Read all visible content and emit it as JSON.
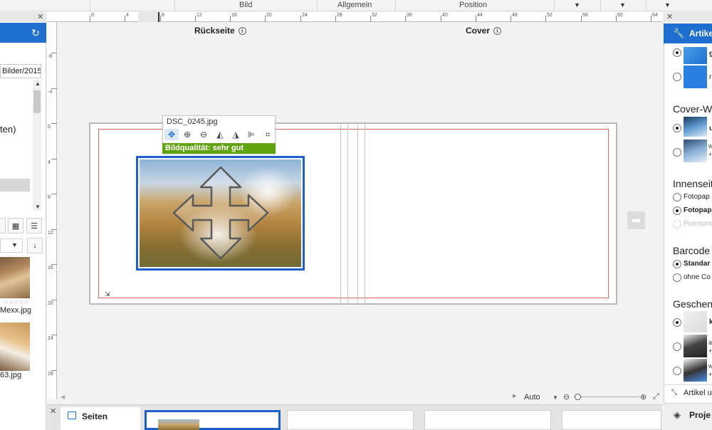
{
  "menu": {
    "tab_bild": "Bild",
    "tab_allgemein": "Allgemein",
    "tab_position": "Position"
  },
  "ruler": {
    "top_ticks": [
      "0",
      "4",
      "8",
      "12",
      "16",
      "20",
      "24",
      "28",
      "32",
      "36",
      "40",
      "44",
      "48",
      "52",
      "56",
      "60",
      "64"
    ],
    "left_ticks": [
      "-8",
      "-4",
      "0",
      "4",
      "8",
      "12",
      "16",
      "20",
      "24",
      "28"
    ]
  },
  "left_panel": {
    "path": "Bilder/2015/",
    "tree_text": "ten)",
    "photos": [
      {
        "filename": "Mexx.jpg",
        "stars": "☆☆☆☆☆"
      },
      {
        "filename": "63.jpg"
      }
    ]
  },
  "workspace": {
    "back_label": "Rückseite",
    "cover_label": "Cover",
    "info_glyph": "i",
    "zoom_value": "Auto"
  },
  "photo_popup": {
    "filename": "DSC_0245.jpg",
    "quality": "Bildqualität: sehr gut"
  },
  "pages": {
    "label": "Seiten"
  },
  "right_panel": {
    "title": "Artikel",
    "cover_header": "Cover-Wa",
    "inner_header": "Innenseit",
    "inner_options": [
      "Fotopap",
      "Fotopap",
      "Premium"
    ],
    "barcode_header": "Barcode",
    "barcode_options": [
      "Standar",
      "ohne Co"
    ],
    "gift_header": "Geschen",
    "gift_option_first": "k",
    "collapse_label": "Artikel u",
    "project_label": "Proje",
    "swatch_top_label": "g",
    "swatch_second_label": "r",
    "cover_first_label": "u",
    "cover_second_label": "w",
    "gift_tiny_1": "a",
    "gift_tiny_2": "w",
    "plus_glyph": "+"
  },
  "colors": {
    "accent": "#1e6fd0",
    "quality_ok": "#61a30f",
    "safe_line": "#d96a6a",
    "photo_frame": "#1f5fc8"
  }
}
